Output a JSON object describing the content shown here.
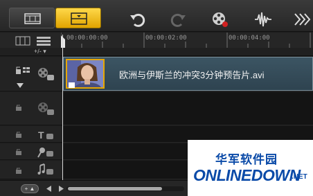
{
  "toolbar": {
    "buttons": [
      "storyboard-view",
      "timeline-view",
      "undo",
      "redo",
      "record-capture",
      "sound-mixer",
      "auto-music"
    ]
  },
  "ruler": {
    "timecodes": [
      "00:00:00:00",
      "00:00:02:00",
      "00:00:04:00"
    ]
  },
  "zoom_control": "+/- ▾",
  "clip": {
    "filename": "欧洲与伊斯兰的冲突3分钟预告片.avi"
  },
  "tracks": [
    "video-track",
    "overlay-track",
    "title-track",
    "voice-track",
    "music-track"
  ],
  "bottom": {
    "add_label": "+ ▲"
  },
  "watermark": {
    "chinese": "华军软件园",
    "english": "ONLINEDOWN",
    "tld": ".NET"
  },
  "colors": {
    "accent": "#f0b400",
    "clip": "#3c5563",
    "watermark_blue": "#0a4aa8"
  }
}
